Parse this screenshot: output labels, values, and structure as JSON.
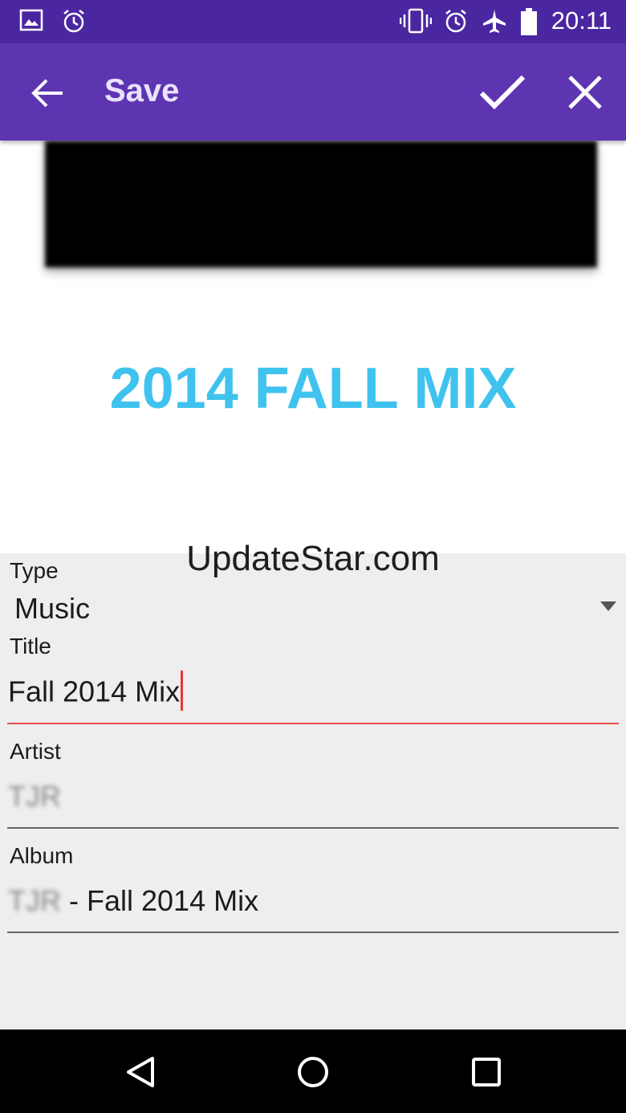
{
  "status_bar": {
    "time": "20:11",
    "icons": [
      "image-icon",
      "alarm-icon",
      "vibrate-icon",
      "alarm-icon",
      "airplane-icon",
      "battery-icon"
    ]
  },
  "app_bar": {
    "title": "Save",
    "icons": [
      "back-arrow-icon",
      "check-icon",
      "close-icon"
    ],
    "color": "#5e35b1"
  },
  "artwork": {
    "mix_title": "2014 FALL MIX",
    "mix_title_color": "#3fc3ee"
  },
  "watermark": "UpdateStar.com",
  "form": {
    "type": {
      "label": "Type",
      "value": "Music"
    },
    "title": {
      "label": "Title",
      "value": "Fall 2014 Mix"
    },
    "artist": {
      "label": "Artist",
      "value": "TJR"
    },
    "album": {
      "label": "Album",
      "value_artist": "TJR",
      "value_rest": " - Fall 2014 Mix"
    }
  },
  "nav_bar": {
    "icons": [
      "back-triangle-icon",
      "home-circle-icon",
      "recents-square-icon"
    ]
  }
}
